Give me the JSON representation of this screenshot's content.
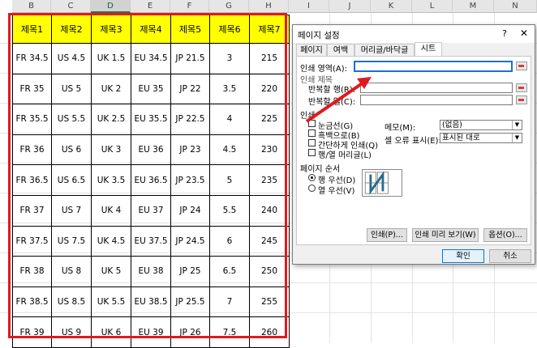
{
  "columns": [
    "B",
    "C",
    "D",
    "E",
    "F",
    "G",
    "H",
    "I",
    "J",
    "K",
    "L",
    "M",
    "N"
  ],
  "selected_column": "D",
  "table": {
    "headers": [
      "제목1",
      "제목2",
      "제목3",
      "제목4",
      "제목5",
      "제목6",
      "제목7"
    ],
    "rows": [
      [
        "FR 34.5",
        "US 4.5",
        "UK 1.5",
        "EU 34.5",
        "JP 21.5",
        "3",
        "215"
      ],
      [
        "FR 35",
        "US 5",
        "UK 2",
        "EU 35",
        "JP 22",
        "3.5",
        "220"
      ],
      [
        "FR 35.5",
        "US 5.5",
        "UK 2.5",
        "EU 35.5",
        "JP 22.5",
        "4",
        "225"
      ],
      [
        "FR 36",
        "US 6",
        "UK 3",
        "EU 36",
        "JP 23",
        "4.5",
        "230"
      ],
      [
        "FR 36.5",
        "US 6.5",
        "UK 3.5",
        "EU 36.5",
        "JP 23.5",
        "5",
        "235"
      ],
      [
        "FR 37",
        "US 7",
        "UK 4",
        "EU 37",
        "JP 24",
        "5.5",
        "240"
      ],
      [
        "FR 37.5",
        "US 7.5",
        "UK 4.5",
        "EU 37.5",
        "JP 24.5",
        "6",
        "245"
      ],
      [
        "FR 38",
        "US 8",
        "UK 5",
        "EU 38",
        "JP 25",
        "6.5",
        "250"
      ],
      [
        "FR 38.5",
        "US 8.5",
        "UK 5.5",
        "EU 38.5",
        "JP 25.5",
        "7",
        "255"
      ],
      [
        "FR 39",
        "US 9",
        "UK 6",
        "EU 39",
        "JP 26",
        "7.5",
        "260"
      ]
    ]
  },
  "dialog": {
    "title": "페이지 설정",
    "help": "?",
    "close": "✕",
    "tabs": [
      "페이지",
      "여백",
      "머리글/바닥글",
      "시트"
    ],
    "active_tab": "시트",
    "print_area_label": "인쇄 영역(A):",
    "print_area_value": "",
    "print_titles_label": "인쇄 제목",
    "repeat_rows_label": "반복할 행(R):",
    "repeat_cols_label": "반복할 열(C):",
    "print_section_label": "인쇄",
    "checkboxes": [
      "눈금선(G)",
      "흑백으로(B)",
      "간단하게 인쇄(Q)",
      "행/열 머리글(L)"
    ],
    "comments_label": "메모(M):",
    "comments_value": "(없음)",
    "errors_label": "셀 오류 표시(E):",
    "errors_value": "표시된 대로",
    "page_order_label": "페이지 순서",
    "order_options": [
      "행 우선(D)",
      "열 우선(V)"
    ],
    "print_button": "인쇄(P)...",
    "preview_button": "인쇄 미리 보기(W)",
    "options_button": "옵션(O)...",
    "ok_button": "확인",
    "cancel_button": "취소"
  },
  "colors": {
    "highlight_red": "#e0191f",
    "header_yellow": "#ffff00",
    "excel_green": "#217346"
  }
}
